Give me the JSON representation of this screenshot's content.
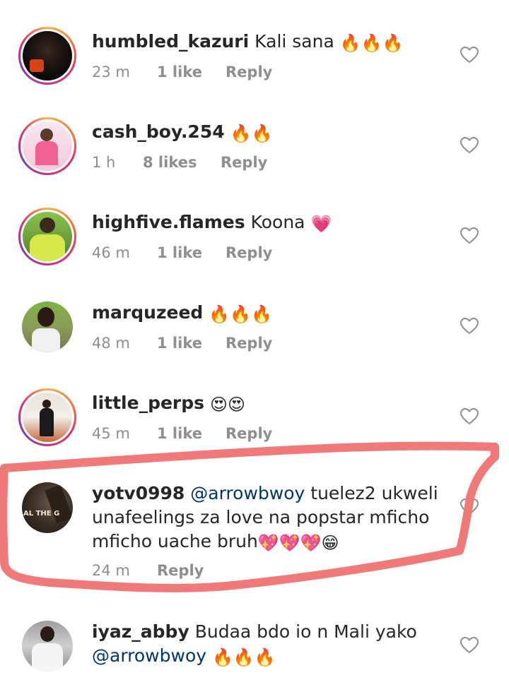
{
  "comments": [
    {
      "username": "humbled_kazuri",
      "text": "Kali sana",
      "emoji": "🔥🔥🔥",
      "time": "23 m",
      "likes": "1 like",
      "reply": "Reply",
      "story_ring": true
    },
    {
      "username": "cash_boy.254",
      "text": "",
      "emoji": "🔥🔥",
      "time": "1 h",
      "likes": "8 likes",
      "reply": "Reply",
      "story_ring": true
    },
    {
      "username": "highfive.flames",
      "text": "Koona",
      "emoji": "💗",
      "time": "46 m",
      "likes": "1 like",
      "reply": "Reply",
      "story_ring": true
    },
    {
      "username": "marquzeed",
      "text": "",
      "emoji": "🔥🔥🔥",
      "time": "48 m",
      "likes": "1 like",
      "reply": "Reply",
      "story_ring": false
    },
    {
      "username": "little_perps",
      "text": "",
      "emoji": "😍😍",
      "time": "45 m",
      "likes": "1 like",
      "reply": "Reply",
      "story_ring": true
    },
    {
      "username": "yotv0998",
      "mention": "@arrowbwoy",
      "text": "tuelez2 ukweli unafeelings za love na popstar mficho mficho uache bruh",
      "emoji": "💖💖💖😁",
      "time": "24 m",
      "likes": "",
      "reply": "Reply",
      "story_ring": false,
      "avatar_text": "AL THE G"
    },
    {
      "username": "iyaz_abby",
      "text": "Budaa bdo io n Mali yako",
      "mention": "@arrowbwoy",
      "emoji": "🔥🔥🔥",
      "story_ring": false
    }
  ],
  "colors": {
    "highlight": "#f07a7a",
    "accent_ring": "#e1306c",
    "mention": "#00376b",
    "muted": "#8e8e8e"
  },
  "icons": {
    "like": "heart-outline-icon"
  }
}
